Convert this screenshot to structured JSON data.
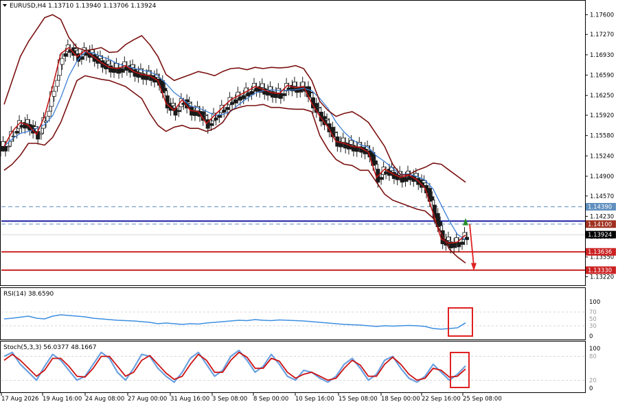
{
  "header": {
    "symbol_line": "EURUSD,H4  1.13710 1.13940 1.13706 1.13924"
  },
  "colors": {
    "candle": "#1a1a1a",
    "bollinger": "#7a1010",
    "ma_fast": "#c01515",
    "ma_slow": "#3d7fd6",
    "support": "#cc2222",
    "resistance": "#1a1aa0",
    "dashed_level": "#5f8fbf",
    "rsi": "#3d8fe0",
    "stoch_main": "#6aa0e0",
    "stoch_signal": "#cc1010",
    "annotation": "#e02020",
    "up_arrow": "#2a8f2a"
  },
  "chart_data": [
    {
      "type": "candlestick",
      "title": "EURUSD,H4",
      "ohlc_last": {
        "open": 1.1371,
        "high": 1.1394,
        "low": 1.13706,
        "close": 1.13924
      },
      "ylim": [
        1.131,
        1.178
      ],
      "y_ticks": [
        "1.17600",
        "1.17270",
        "1.16930",
        "1.16590",
        "1.16250",
        "1.15920",
        "1.15580",
        "1.15240",
        "1.14900",
        "1.14570",
        "1.14230",
        "1.13890",
        "1.13550",
        "1.13220"
      ],
      "x_ticks": [
        "17 Aug 2026",
        "19 Aug 16:00",
        "24 Aug 08:00",
        "27 Aug 00:00",
        "31 Aug 16:00",
        "3 Sep 08:00",
        "8 Sep 00:00",
        "10 Sep 16:00",
        "15 Sep 08:00",
        "18 Sep 00:00",
        "22 Sep 16:00",
        "25 Sep 08:00"
      ],
      "close_series": [
        1.154,
        1.1565,
        1.158,
        1.1575,
        1.156,
        1.159,
        1.164,
        1.1695,
        1.1705,
        1.169,
        1.17,
        1.169,
        1.168,
        1.1672,
        1.167,
        1.1675,
        1.1665,
        1.166,
        1.1658,
        1.165,
        1.1612,
        1.16,
        1.1618,
        1.16,
        1.1598,
        1.1578,
        1.1592,
        1.1605,
        1.1618,
        1.1625,
        1.1632,
        1.164,
        1.1635,
        1.163,
        1.1628,
        1.1642,
        1.1638,
        1.164,
        1.1612,
        1.159,
        1.1572,
        1.1548,
        1.1545,
        1.154,
        1.1538,
        1.153,
        1.1488,
        1.1502,
        1.1494,
        1.1488,
        1.1492,
        1.1484,
        1.147,
        1.1428,
        1.1385,
        1.1378,
        1.138,
        1.1392
      ],
      "bollinger_upper": [
        1.161,
        1.165,
        1.169,
        1.1715,
        1.1735,
        1.1755,
        1.176,
        1.1752,
        1.1722,
        1.1705,
        1.17,
        1.1702,
        1.1705,
        1.1697,
        1.1698,
        1.171,
        1.1718,
        1.1725,
        1.171,
        1.169,
        1.166,
        1.165,
        1.1655,
        1.166,
        1.1665,
        1.1662,
        1.1658,
        1.1665,
        1.167,
        1.1671,
        1.1668,
        1.1672,
        1.167,
        1.1672,
        1.1671,
        1.1672,
        1.1675,
        1.167,
        1.165,
        1.1615,
        1.16,
        1.159,
        1.1595,
        1.1598,
        1.159,
        1.158,
        1.156,
        1.154,
        1.151,
        1.1492,
        1.1493,
        1.15,
        1.1505,
        1.1512,
        1.151,
        1.15,
        1.149,
        1.148
      ],
      "bollinger_lower": [
        1.15,
        1.151,
        1.1525,
        1.1545,
        1.1545,
        1.1542,
        1.1555,
        1.158,
        1.1615,
        1.165,
        1.1658,
        1.1655,
        1.1652,
        1.165,
        1.1645,
        1.164,
        1.163,
        1.162,
        1.1595,
        1.1575,
        1.1565,
        1.1572,
        1.1575,
        1.157,
        1.157,
        1.1565,
        1.157,
        1.158,
        1.16,
        1.1605,
        1.1608,
        1.1608,
        1.161,
        1.1605,
        1.1605,
        1.1603,
        1.1602,
        1.1602,
        1.1598,
        1.1558,
        1.1535,
        1.1518,
        1.151,
        1.1508,
        1.15,
        1.15,
        1.148,
        1.146,
        1.145,
        1.1445,
        1.144,
        1.1435,
        1.1432,
        1.142,
        1.1395,
        1.1368,
        1.1355,
        1.1345
      ]
    },
    {
      "type": "line",
      "title": "RSI(14) 38.6590",
      "ylim": [
        0,
        100
      ],
      "y_ticks": [
        "100",
        "70",
        "50",
        "30",
        "0"
      ],
      "series": [
        {
          "name": "RSI(14)",
          "values": [
            50,
            52,
            55,
            58,
            52,
            50,
            58,
            62,
            60,
            58,
            56,
            52,
            50,
            48,
            46,
            45,
            44,
            42,
            40,
            36,
            38,
            36,
            34,
            36,
            35,
            38,
            40,
            42,
            44,
            46,
            45,
            48,
            46,
            45,
            47,
            46,
            45,
            44,
            42,
            40,
            38,
            36,
            34,
            33,
            32,
            30,
            28,
            30,
            29,
            30,
            31,
            30,
            28,
            22,
            20,
            22,
            24,
            38.66
          ]
        }
      ]
    },
    {
      "type": "line",
      "title": "Stoch(5,3,3) 56.0377 48.1667",
      "ylim": [
        0,
        100
      ],
      "y_ticks": [
        "100",
        "80",
        "20",
        "0"
      ],
      "series": [
        {
          "name": "Stoch main",
          "values": [
            80,
            90,
            60,
            40,
            20,
            55,
            85,
            70,
            45,
            20,
            30,
            60,
            90,
            75,
            40,
            20,
            50,
            85,
            80,
            50,
            30,
            15,
            40,
            75,
            90,
            60,
            30,
            45,
            80,
            95,
            70,
            40,
            55,
            85,
            60,
            30,
            20,
            45,
            40,
            25,
            15,
            30,
            60,
            75,
            50,
            20,
            35,
            70,
            80,
            50,
            25,
            15,
            30,
            60,
            40,
            20,
            35,
            56.04
          ]
        },
        {
          "name": "Stoch signal",
          "values": [
            70,
            85,
            70,
            50,
            30,
            45,
            75,
            75,
            55,
            30,
            28,
            50,
            80,
            80,
            55,
            30,
            40,
            70,
            82,
            60,
            38,
            22,
            30,
            60,
            85,
            70,
            40,
            40,
            70,
            90,
            78,
            50,
            50,
            75,
            68,
            40,
            25,
            35,
            40,
            30,
            20,
            25,
            50,
            70,
            58,
            30,
            30,
            60,
            78,
            60,
            35,
            20,
            25,
            50,
            45,
            28,
            30,
            48.17
          ]
        }
      ]
    }
  ],
  "levels": {
    "dashed_1": "1.14390",
    "dashed_2": "1.14100",
    "blue": "1.14150",
    "current": "1.13924",
    "red_1": "1.13636",
    "red_2": "1.13330"
  }
}
